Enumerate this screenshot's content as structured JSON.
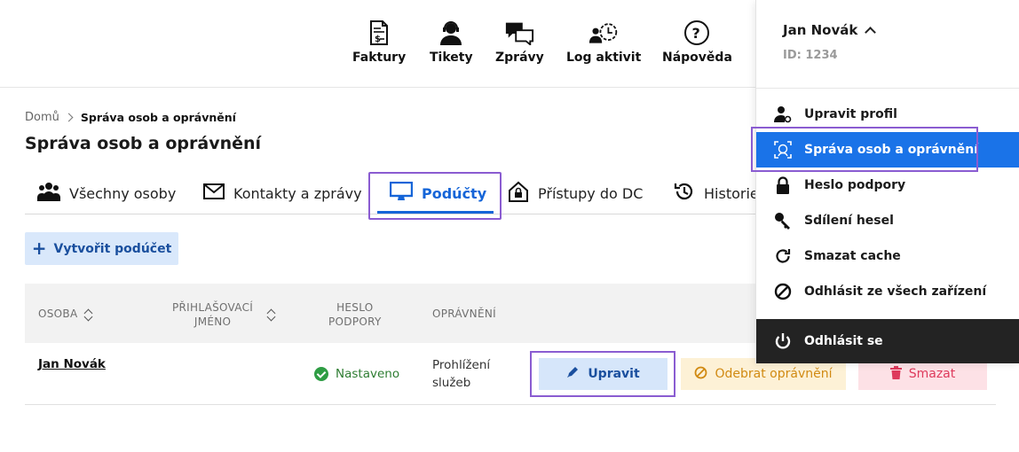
{
  "header": {
    "nav": [
      {
        "label": "Faktury",
        "icon": "invoice-icon"
      },
      {
        "label": "Tikety",
        "icon": "support-agent-icon"
      },
      {
        "label": "Zprávy",
        "icon": "chat-bubbles-icon"
      },
      {
        "label": "Log aktivit",
        "icon": "activity-log-icon"
      },
      {
        "label": "Nápověda",
        "icon": "help-icon"
      }
    ]
  },
  "breadcrumb": {
    "home": "Domů",
    "current": "Správa osob a oprávnění"
  },
  "page_title": "Správa osob a oprávnění",
  "tabs": [
    {
      "label": "Všechny osoby",
      "icon": "people-icon"
    },
    {
      "label": "Kontakty a zprávy",
      "icon": "envelope-icon"
    },
    {
      "label": "Podúčty",
      "icon": "monitor-icon",
      "active": true
    },
    {
      "label": "Přístupy do DC",
      "icon": "house-lock-icon"
    },
    {
      "label": "Historie",
      "icon": "history-icon"
    }
  ],
  "create_button": "Vytvořit podúčet",
  "table": {
    "headers": {
      "osoba": "OSOBA",
      "login_1": "PŘIHLAŠOVACÍ",
      "login_2": "JMÉNO",
      "heslo_1": "HESLO",
      "heslo_2": "PODPORY",
      "opravneni": "OPRÁVNĚNÍ"
    },
    "rows": [
      {
        "name": "Jan Novák",
        "status": "Nastaveno",
        "permission_1": "Prohlížení",
        "permission_2": "služeb",
        "edit": "Upravit",
        "revoke": "Odebrat oprávnění",
        "delete": "Smazat"
      }
    ]
  },
  "user_menu": {
    "name": "Jan Novák",
    "id": "ID: 1234",
    "items": [
      {
        "label": "Upravit profil",
        "icon": "user-settings-icon"
      },
      {
        "label": "Správa osob a oprávnění",
        "icon": "face-scan-icon",
        "active": true
      },
      {
        "label": "Heslo podpory",
        "icon": "lock-icon"
      },
      {
        "label": "Sdílení hesel",
        "icon": "key-icon"
      },
      {
        "label": "Smazat cache",
        "icon": "refresh-icon"
      },
      {
        "label": "Odhlásit ze všech zařízení",
        "icon": "block-icon"
      }
    ],
    "logout": "Odhlásit se"
  },
  "colors": {
    "accent": "#1a73e8",
    "highlight": "#8a5cd1",
    "success": "#2e9d44",
    "warning": "#d18a12",
    "danger": "#de3a5c"
  }
}
